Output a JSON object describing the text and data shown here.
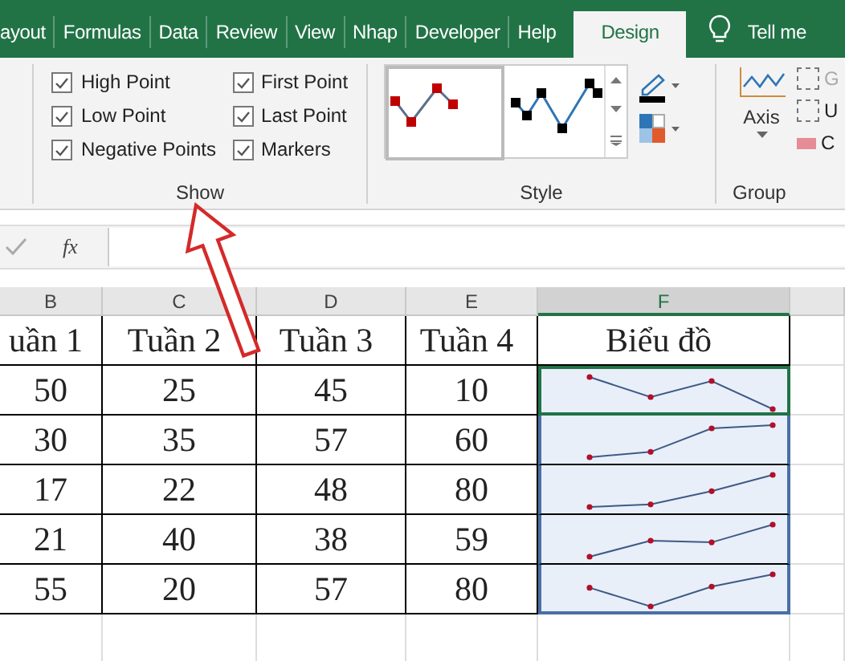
{
  "tabs": [
    {
      "label": "ayout",
      "selected": false
    },
    {
      "label": "Formulas",
      "selected": false
    },
    {
      "label": "Data",
      "selected": false
    },
    {
      "label": "Review",
      "selected": false
    },
    {
      "label": "View",
      "selected": false
    },
    {
      "label": "Nhap",
      "selected": false
    },
    {
      "label": "Developer",
      "selected": false
    },
    {
      "label": "Help",
      "selected": false
    },
    {
      "label": "Design",
      "selected": true
    }
  ],
  "tell_me": "Tell me",
  "show_group": {
    "label": "Show",
    "options": [
      {
        "label": "High Point",
        "checked": true
      },
      {
        "label": "Low Point",
        "checked": true
      },
      {
        "label": "Negative Points",
        "checked": true
      },
      {
        "label": "First Point",
        "checked": true
      },
      {
        "label": "Last Point",
        "checked": true
      },
      {
        "label": "Markers",
        "checked": true
      }
    ]
  },
  "style_group": {
    "label": "Style"
  },
  "group_group": {
    "axis": "Axis",
    "buttons": [
      "G",
      "U",
      "C"
    ],
    "label": "Group"
  },
  "formula_bar": {
    "function_label": "fx"
  },
  "sheet": {
    "columns": [
      {
        "label": "B",
        "selected": false
      },
      {
        "label": "C",
        "selected": false
      },
      {
        "label": "D",
        "selected": false
      },
      {
        "label": "E",
        "selected": false
      },
      {
        "label": "F",
        "selected": true
      }
    ],
    "header_row": [
      "uần 1",
      "Tuần 2",
      "Tuần 3",
      "Tuần 4",
      "Biểu đồ"
    ],
    "rows": [
      [
        "50",
        "25",
        "45",
        "10"
      ],
      [
        "30",
        "35",
        "57",
        "60"
      ],
      [
        "17",
        "22",
        "48",
        "80"
      ],
      [
        "21",
        "40",
        "38",
        "59"
      ],
      [
        "55",
        "20",
        "57",
        "80"
      ]
    ]
  }
}
